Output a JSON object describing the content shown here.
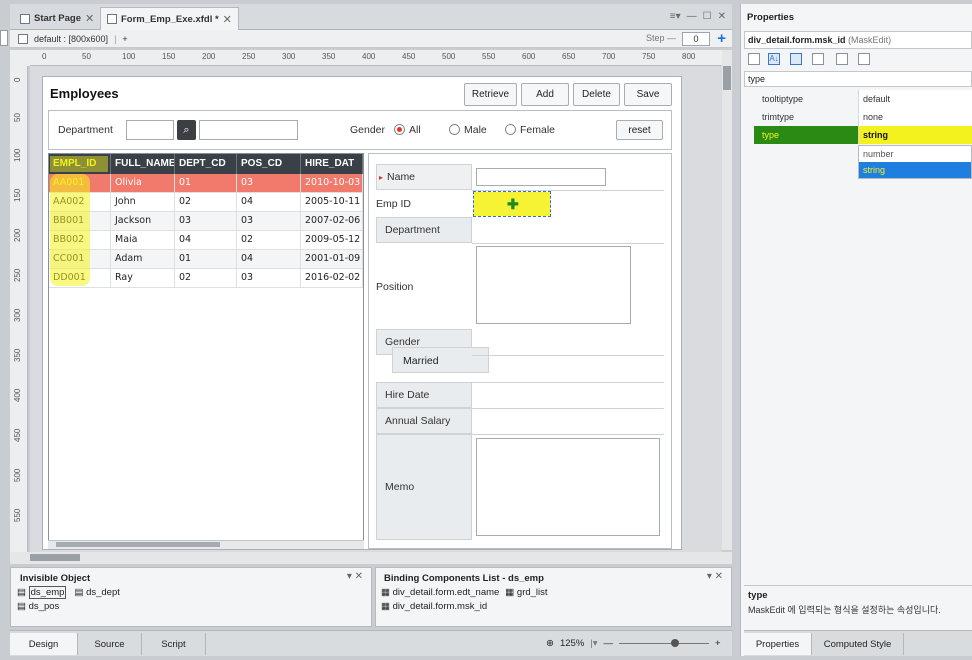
{
  "tabs": [
    {
      "label": "Start Page"
    },
    {
      "label": "Form_Emp_Exe.xfdl *"
    }
  ],
  "toolbar": {
    "screen": "default : [800x600]",
    "add": "+",
    "step_label": "Step",
    "step_value": "0"
  },
  "ruler": {
    "h": [
      "0",
      "50",
      "100",
      "150",
      "200",
      "250",
      "300",
      "350",
      "400",
      "450",
      "500",
      "550",
      "600",
      "650",
      "700",
      "750",
      "800"
    ],
    "v": [
      "0",
      "50",
      "100",
      "150",
      "200",
      "250",
      "300",
      "350",
      "400",
      "450",
      "500",
      "550"
    ]
  },
  "form": {
    "title": "Employees",
    "buttons": {
      "retrieve": "Retrieve",
      "add": "Add",
      "delete": "Delete",
      "save": "Save"
    },
    "search": {
      "department_label": "Department",
      "gender_label": "Gender",
      "all": "All",
      "male": "Male",
      "female": "Female",
      "reset": "reset"
    },
    "grid": {
      "columns": [
        "EMPL_ID",
        "FULL_NAME",
        "DEPT_CD",
        "POS_CD",
        "HIRE_DAT"
      ],
      "rows": [
        [
          "AA001",
          "Olivia",
          "01",
          "03",
          "2010-10-03"
        ],
        [
          "AA002",
          "John",
          "02",
          "04",
          "2005-10-11"
        ],
        [
          "BB001",
          "Jackson",
          "03",
          "03",
          "2007-02-06"
        ],
        [
          "BB002",
          "Maia",
          "04",
          "02",
          "2009-05-12"
        ],
        [
          "CC001",
          "Adam",
          "01",
          "04",
          "2001-01-09"
        ],
        [
          "DD001",
          "Ray",
          "02",
          "03",
          "2016-02-02"
        ]
      ]
    },
    "detail": {
      "name": "Name",
      "emp_id": "Emp ID",
      "department": "Department",
      "position": "Position",
      "gender": "Gender",
      "married": "Married",
      "hire_date": "Hire Date",
      "annual_salary": "Annual Salary",
      "memo": "Memo"
    }
  },
  "invisible": {
    "title": "Invisible Object",
    "items": [
      "ds_emp",
      "ds_dept",
      "ds_pos"
    ]
  },
  "binding": {
    "title": "Binding Components List - ds_emp",
    "items": [
      "div_detail.form.edt_name",
      "grd_list",
      "div_detail.form.msk_id"
    ]
  },
  "bottom": {
    "tabs": [
      "Design",
      "Source",
      "Script"
    ],
    "zoom": "125%"
  },
  "properties": {
    "title": "Properties",
    "object": "div_detail.form.msk_id",
    "object_type": "(MaskEdit)",
    "filter": "type",
    "rows": [
      {
        "k": "tooltiptype",
        "v": "default"
      },
      {
        "k": "trimtype",
        "v": "none"
      },
      {
        "k": "type",
        "v": "string"
      }
    ],
    "dropdown": [
      "number",
      "string"
    ],
    "help_title": "type",
    "help_text": "MaskEdit 에 입력되는 형식을 설정하는 속성입니다.",
    "tabs": [
      "Properties",
      "Computed Style"
    ]
  },
  "colors": {
    "highlight": "#f4f21e",
    "selected_row": "#f27a6c",
    "accent": "#1a6fd8",
    "grid_header": "#394048"
  }
}
